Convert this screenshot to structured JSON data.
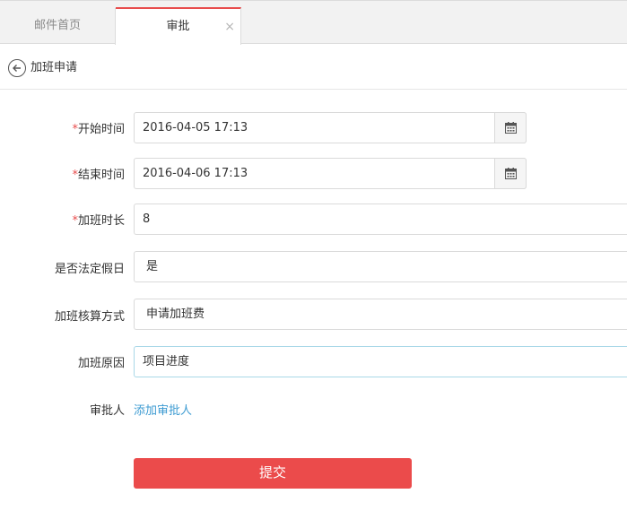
{
  "tabs": [
    {
      "label": "邮件首页"
    },
    {
      "label": "审批",
      "close": "×"
    }
  ],
  "header": {
    "title": "加班申请"
  },
  "form": {
    "required_mark": "*",
    "start_time": {
      "label": "开始时间",
      "value": "2016-04-05 17:13"
    },
    "end_time": {
      "label": "结束时间",
      "value": "2016-04-06 17:13"
    },
    "duration": {
      "label": "加班时长",
      "value": "8"
    },
    "holiday": {
      "label": "是否法定假日",
      "value": "是"
    },
    "accounting": {
      "label": "加班核算方式",
      "value": "申请加班费"
    },
    "reason": {
      "label": "加班原因",
      "value": "项目进度"
    },
    "approver": {
      "label": "审批人",
      "link": "添加审批人"
    }
  },
  "submit_label": "提交",
  "icons": {
    "back": "back-circle-arrow-icon",
    "calendar": "calendar-icon",
    "close": "close-icon"
  },
  "colors": {
    "accent": "#eb4b4b",
    "link": "#3d9bd2"
  }
}
